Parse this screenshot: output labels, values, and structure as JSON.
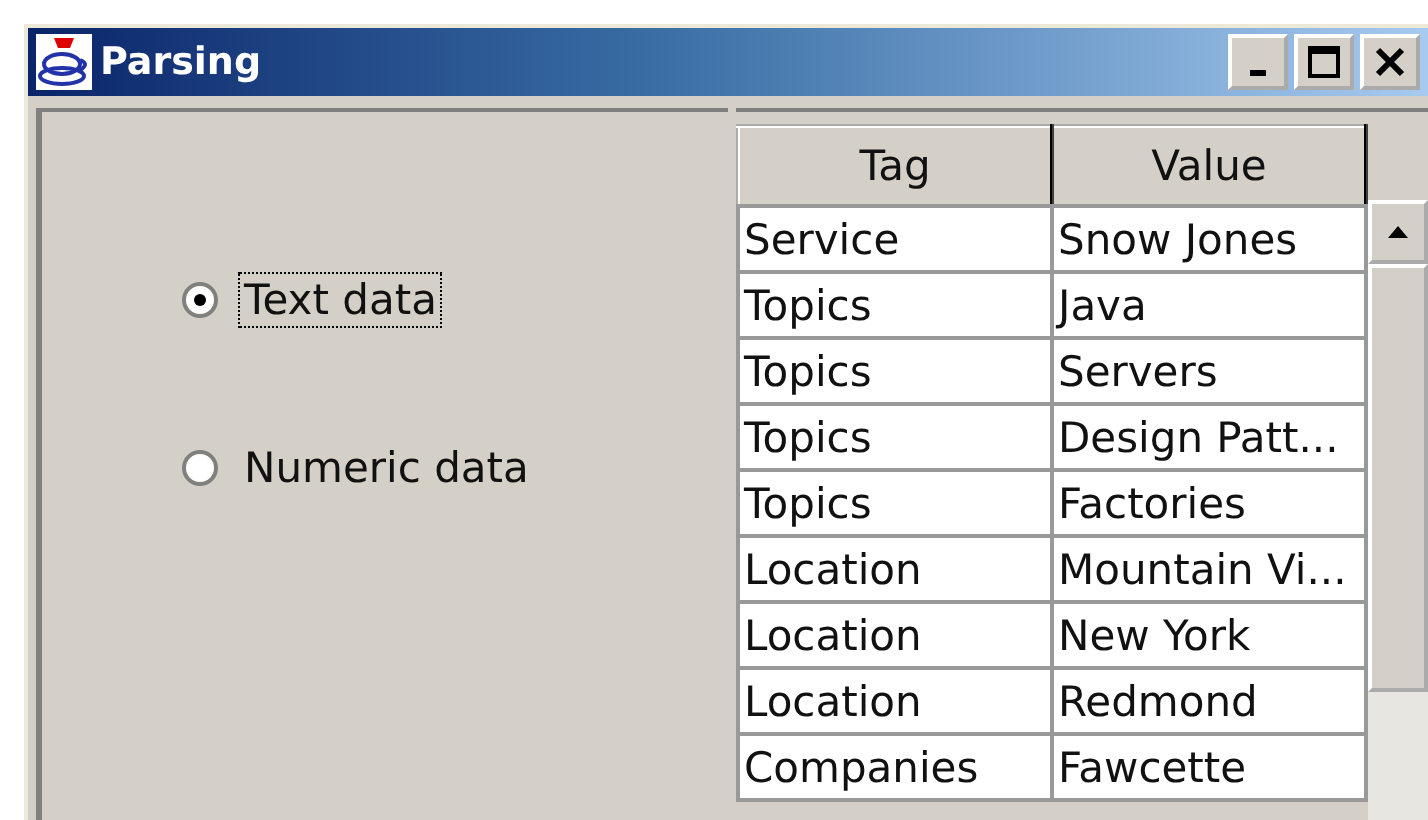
{
  "window": {
    "title": "Parsing"
  },
  "options": [
    {
      "label": "Text data",
      "selected": true,
      "focused": true
    },
    {
      "label": "Numeric data",
      "selected": false,
      "focused": false
    }
  ],
  "table": {
    "columns": [
      "Tag",
      "Value"
    ],
    "rows": [
      [
        "Service",
        "Snow Jones"
      ],
      [
        "Topics",
        "Java"
      ],
      [
        "Topics",
        "Servers"
      ],
      [
        "Topics",
        "Design Patt..."
      ],
      [
        "Topics",
        "Factories"
      ],
      [
        "Location",
        "Mountain Vi..."
      ],
      [
        "Location",
        "New York"
      ],
      [
        "Location",
        "Redmond"
      ],
      [
        "Companies",
        "Fawcette"
      ]
    ]
  }
}
